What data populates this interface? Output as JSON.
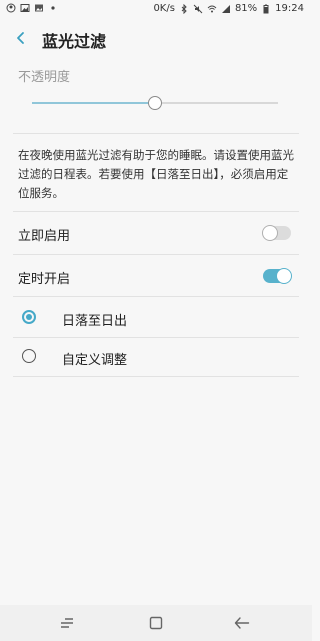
{
  "status_bar": {
    "left_icons": [
      "account-circle-icon",
      "image-icon",
      "gallery-icon",
      "dot-icon"
    ],
    "net_speed": "0K/s",
    "battery": "81%",
    "time": "19:24"
  },
  "app_bar": {
    "title": "蓝光过滤"
  },
  "opacity": {
    "label": "不透明度",
    "value_percent": 50
  },
  "description": "在夜晚使用蓝光过滤有助于您的睡眠。请设置使用蓝光过滤的日程表。若要使用【日落至日出】，必须启用定位服务。",
  "settings": {
    "turn_on_now": {
      "label": "立即启用",
      "enabled": false
    },
    "scheduled": {
      "label": "定时开启",
      "enabled": true
    }
  },
  "schedule_options": [
    {
      "label": "日落至日出",
      "selected": true
    },
    {
      "label": "自定义调整",
      "selected": false
    }
  ],
  "colors": {
    "accent": "#46a9c8",
    "switch_on": "#58b2cc"
  }
}
